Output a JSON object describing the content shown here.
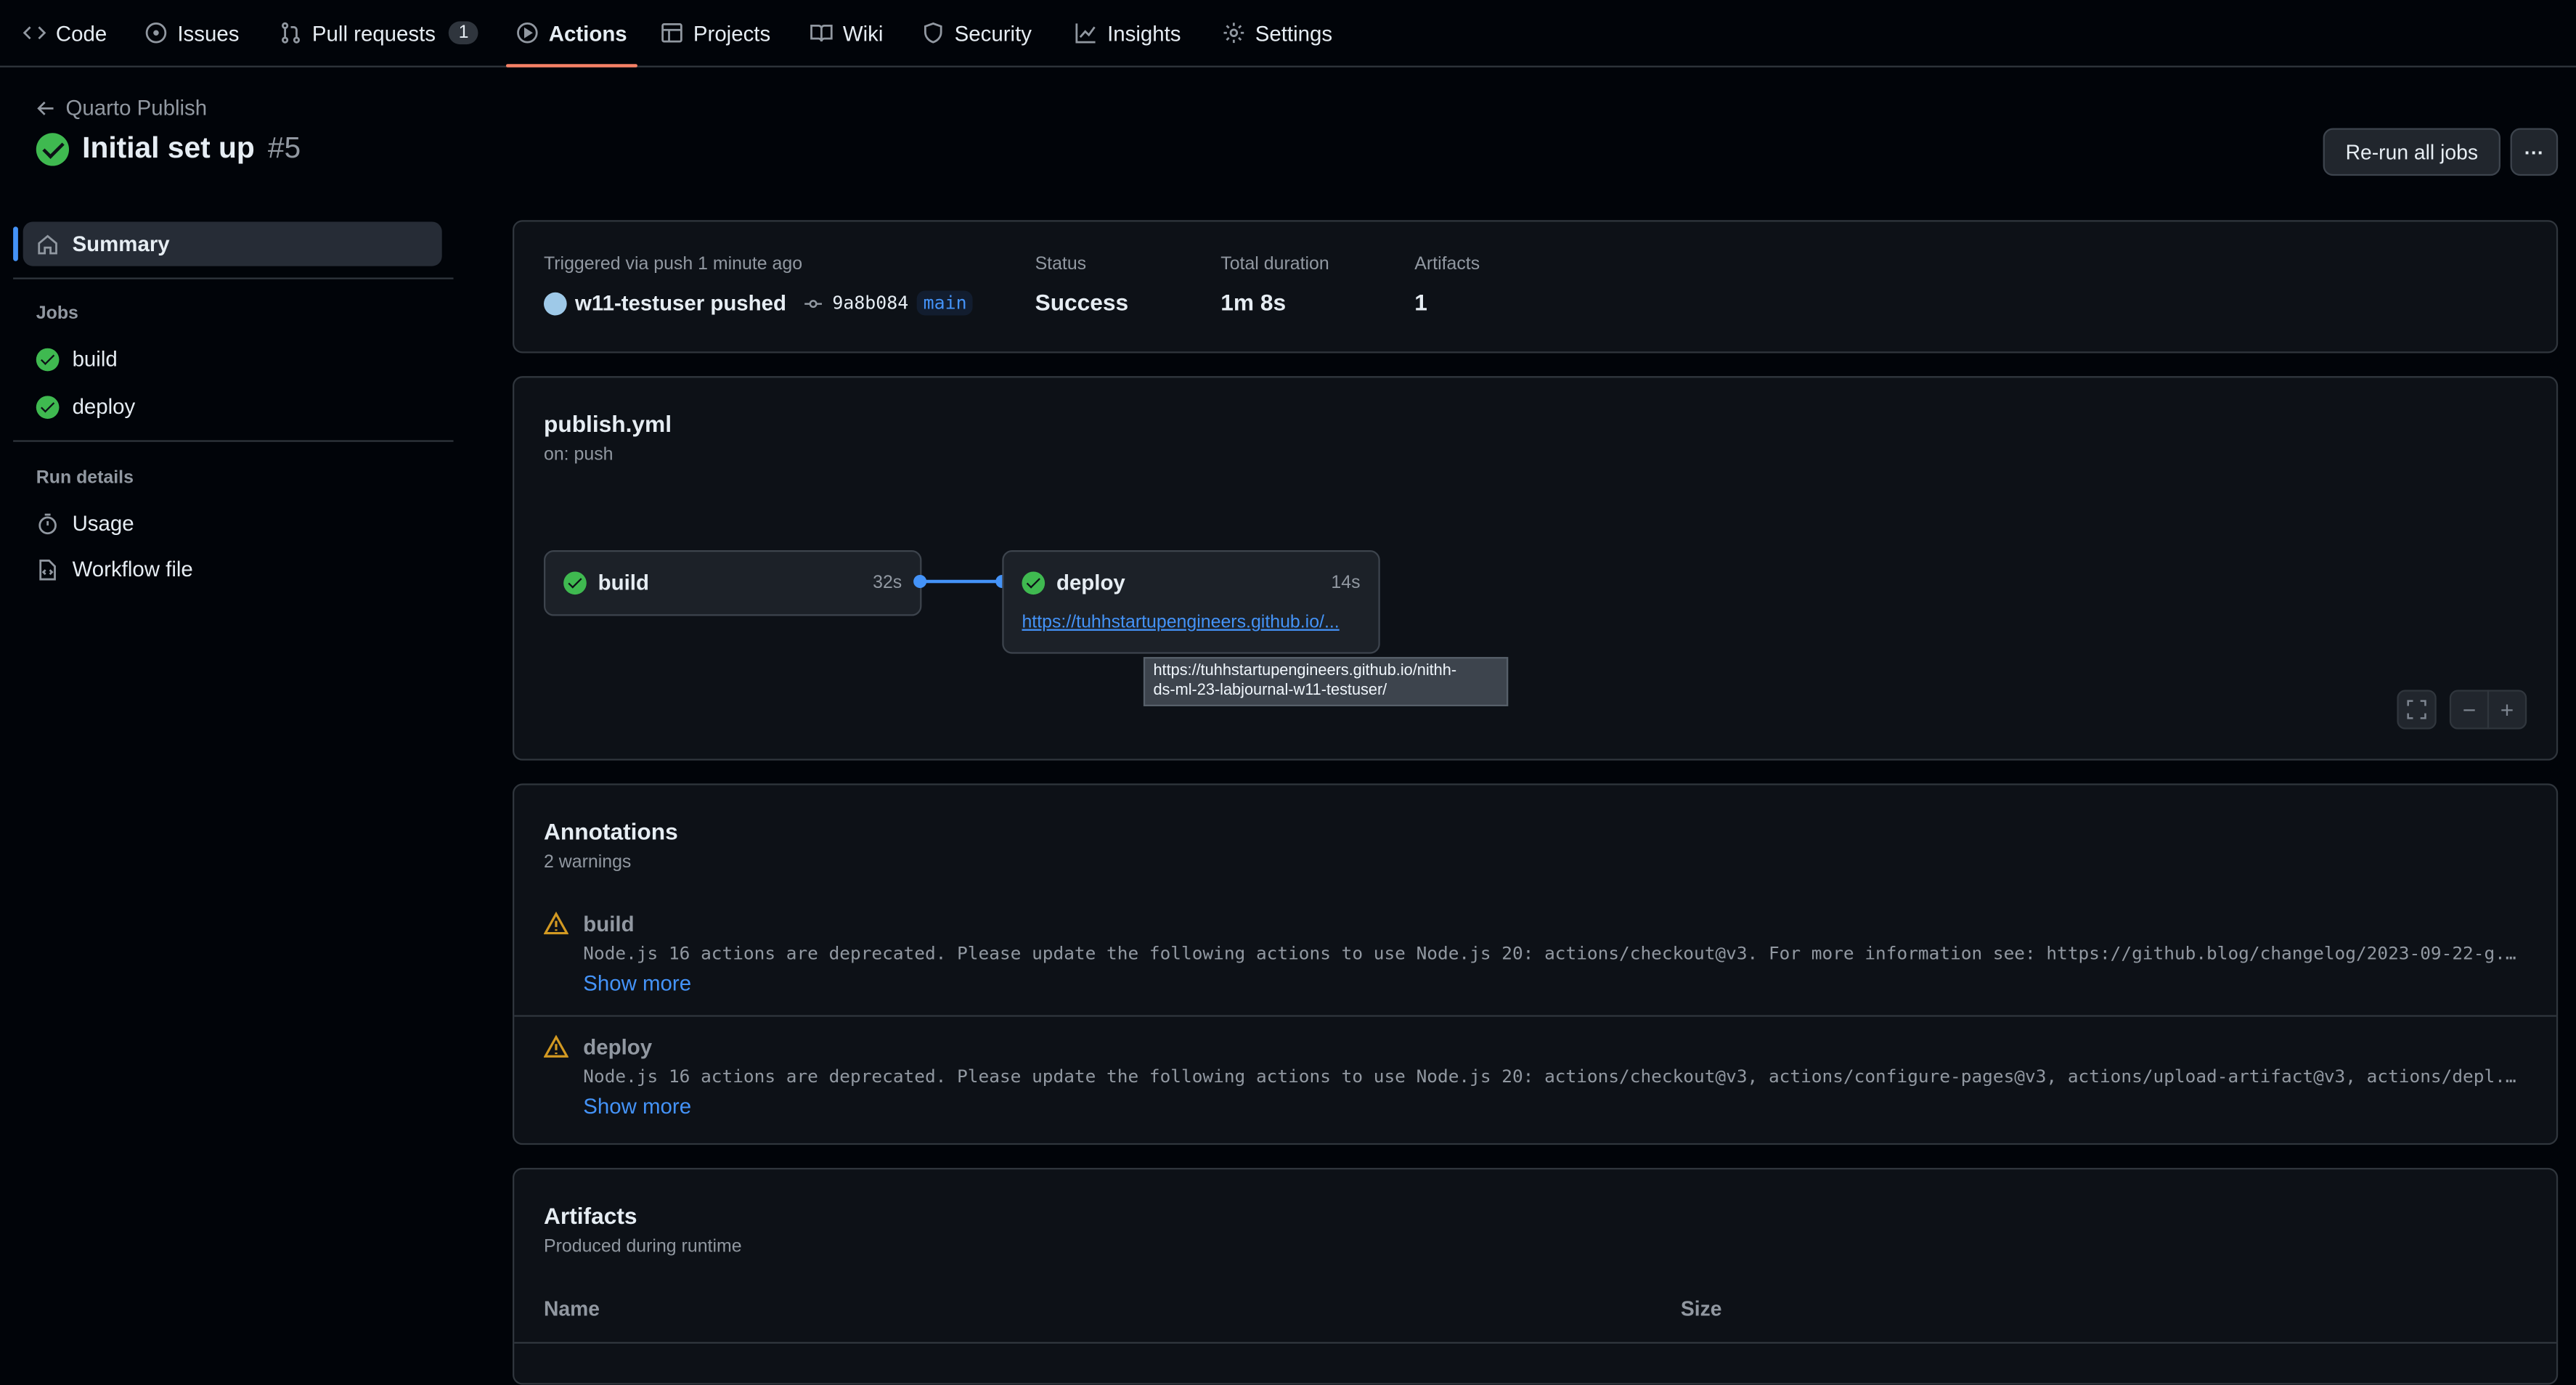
{
  "nav": {
    "code": "Code",
    "issues": "Issues",
    "pull_requests": "Pull requests",
    "pull_requests_count": "1",
    "actions": "Actions",
    "projects": "Projects",
    "wiki": "Wiki",
    "security": "Security",
    "insights": "Insights",
    "settings": "Settings"
  },
  "header": {
    "back_label": "Quarto Publish",
    "title": "Initial set up",
    "run_number": "#5",
    "rerun_label": "Re-run all jobs",
    "more_label": "···"
  },
  "sidebar": {
    "summary": "Summary",
    "jobs_heading": "Jobs",
    "jobs": [
      {
        "label": "build"
      },
      {
        "label": "deploy"
      }
    ],
    "run_details_heading": "Run details",
    "usage": "Usage",
    "workflow_file": "Workflow file"
  },
  "summary": {
    "triggered": "Triggered via push 1 minute ago",
    "actor": "w11-testuser pushed",
    "commit": "9a8b084",
    "branch": "main",
    "status_label": "Status",
    "status_value": "Success",
    "duration_label": "Total duration",
    "duration_value": "1m 8s",
    "artifacts_label": "Artifacts",
    "artifacts_value": "1"
  },
  "workflow": {
    "file": "publish.yml",
    "trigger": "on: push",
    "jobs": [
      {
        "name": "build",
        "duration": "32s"
      },
      {
        "name": "deploy",
        "duration": "14s",
        "url": "https://tuhhstartupengineers.github.io/..."
      }
    ],
    "tooltip_line1": "https://tuhhstartupengineers.github.io/nithh-",
    "tooltip_line2": "ds-ml-23-labjournal-w11-testuser/"
  },
  "annotations": {
    "title": "Annotations",
    "count": "2 warnings",
    "items": [
      {
        "job": "build",
        "message": "Node.js 16 actions are deprecated. Please update the following actions to use Node.js 20: actions/checkout@v3. For more information see: https://github.blog/changelog/2023-09-22-g...",
        "show_more": "Show more"
      },
      {
        "job": "deploy",
        "message": "Node.js 16 actions are deprecated. Please update the following actions to use Node.js 20: actions/checkout@v3, actions/configure-pages@v3, actions/upload-artifact@v3, actions/depl...",
        "show_more": "Show more"
      }
    ]
  },
  "artifacts": {
    "title": "Artifacts",
    "subtitle": "Produced during runtime",
    "col_name": "Name",
    "col_size": "Size"
  },
  "colors": {
    "background": "#010409",
    "panel": "#0d1117",
    "success": "#3fb950",
    "accent": "#4493f8",
    "warning": "#d29922",
    "nav_underline": "#f78166"
  }
}
